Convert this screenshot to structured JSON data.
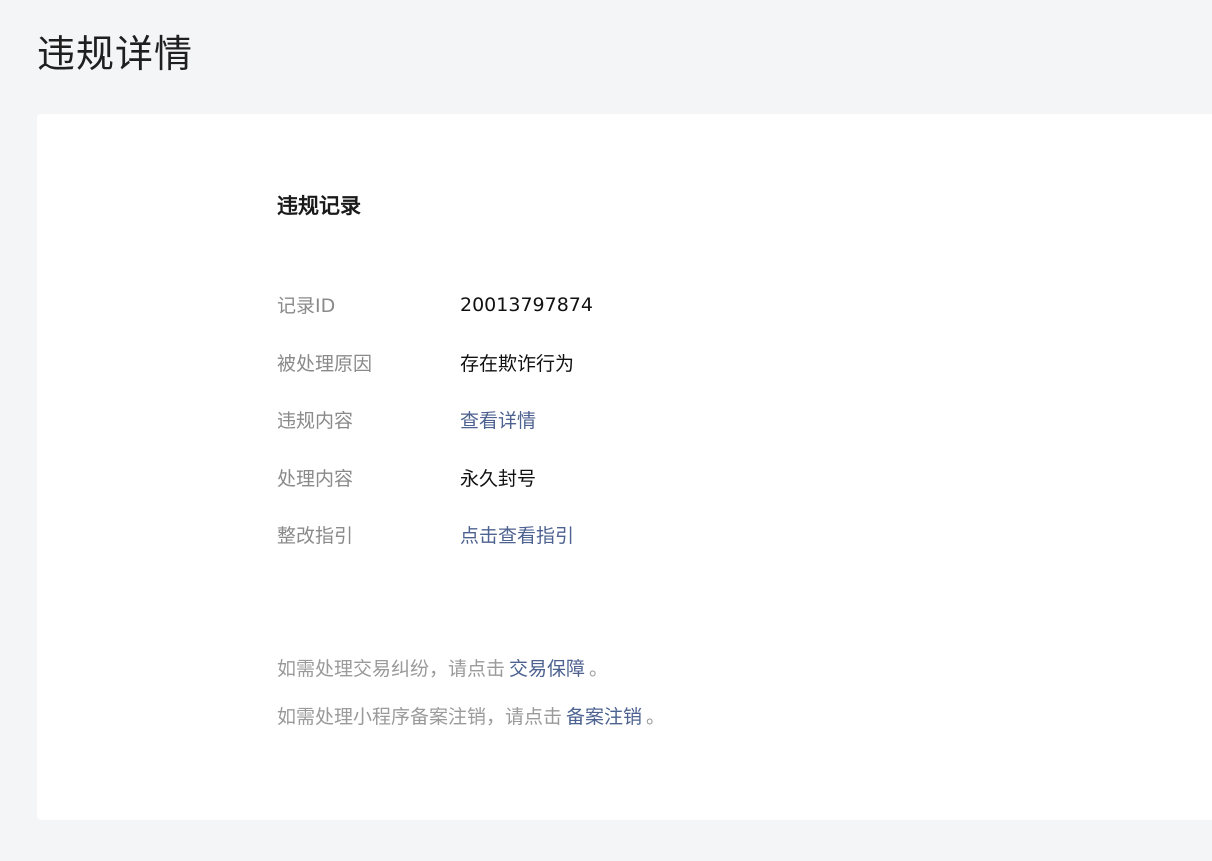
{
  "page": {
    "title": "违规详情"
  },
  "card": {
    "section_title": "违规记录",
    "rows": [
      {
        "label": "记录ID",
        "value": "20013797874"
      },
      {
        "label": "被处理原因",
        "value": "存在欺诈行为"
      },
      {
        "label": "违规内容",
        "link": "查看详情"
      },
      {
        "label": "处理内容",
        "value": "永久封号"
      },
      {
        "label": "整改指引",
        "link": "点击查看指引"
      }
    ],
    "notes": [
      {
        "prefix": "如需处理交易纠纷，请点击",
        "link": "交易保障",
        "suffix": "。"
      },
      {
        "prefix": "如需处理小程序备案注销，请点击",
        "link": "备案注销",
        "suffix": "。"
      }
    ]
  },
  "colors": {
    "background": "#f4f5f7",
    "card": "#ffffff",
    "link": "#4d6290",
    "label": "#8a8a8a",
    "value": "#111111"
  }
}
